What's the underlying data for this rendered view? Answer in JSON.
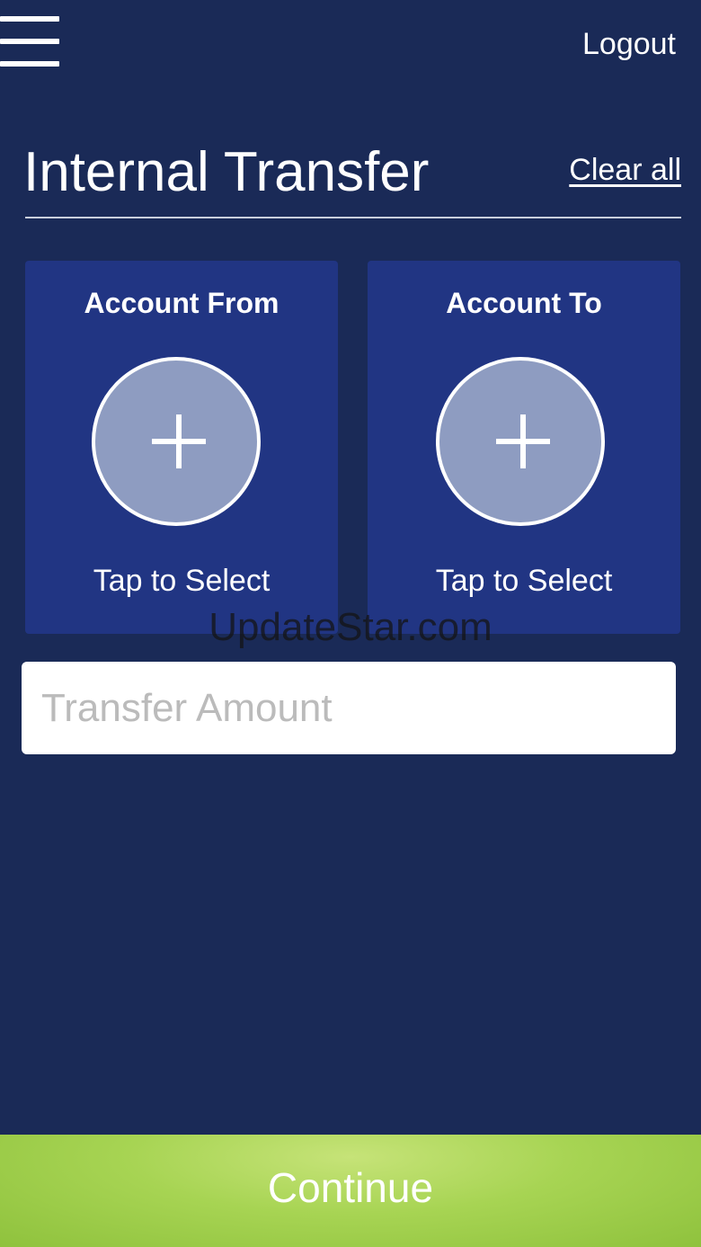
{
  "header": {
    "menu_icon": "hamburger-menu-icon",
    "logout_label": "Logout"
  },
  "page": {
    "title": "Internal Transfer",
    "clear_all_label": "Clear all"
  },
  "accounts": {
    "from": {
      "title": "Account From",
      "icon": "plus-icon",
      "subtitle": "Tap to Select"
    },
    "to": {
      "title": "Account To",
      "icon": "plus-icon",
      "subtitle": "Tap to Select"
    }
  },
  "transfer": {
    "amount_value": "",
    "amount_placeholder": "Transfer Amount"
  },
  "watermark": "UpdateStar.com",
  "footer": {
    "continue_label": "Continue"
  },
  "colors": {
    "background": "#1a2a57",
    "card": "#213583",
    "circle": "#8e9cc1",
    "continue_button": "#a7d453"
  }
}
